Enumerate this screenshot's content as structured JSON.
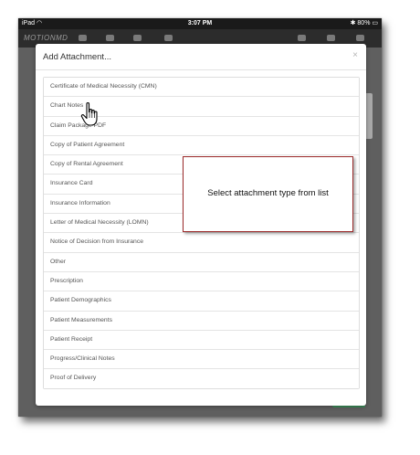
{
  "status_bar": {
    "carrier": "iPad",
    "time": "3:07 PM",
    "battery": "80%",
    "wifi_icon": "wifi-icon",
    "bluetooth_icon": "bluetooth-icon"
  },
  "app_bar": {
    "brand": "MOTIONMD"
  },
  "modal": {
    "title": "Add Attachment...",
    "close_label": "×",
    "items": [
      {
        "label": "Certificate of Medical Necessity (CMN)"
      },
      {
        "label": "Chart Notes"
      },
      {
        "label": "Claim Package PDF"
      },
      {
        "label": "Copy of Patient Agreement"
      },
      {
        "label": "Copy of Rental Agreement"
      },
      {
        "label": "Insurance Card"
      },
      {
        "label": "Insurance Information"
      },
      {
        "label": "Letter of Medical Necessity (LOMN)"
      },
      {
        "label": "Notice of Decision from Insurance"
      },
      {
        "label": "Other"
      },
      {
        "label": "Prescription"
      },
      {
        "label": "Patient Demographics"
      },
      {
        "label": "Patient Measurements"
      },
      {
        "label": "Patient Receipt"
      },
      {
        "label": "Progress/Clinical Notes"
      },
      {
        "label": "Proof of Delivery"
      }
    ]
  },
  "callout": {
    "text": "Select attachment type from list"
  },
  "colors": {
    "callout_border": "#9b2a2a",
    "modal_bg": "#ffffff",
    "overlay": "#5f5f5f"
  }
}
